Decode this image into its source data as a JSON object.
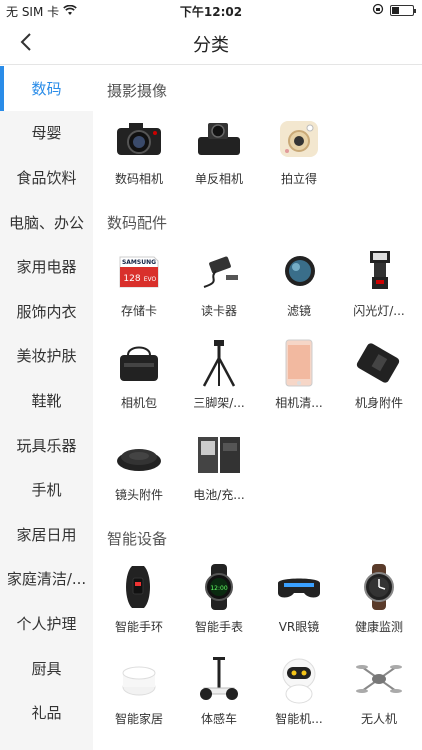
{
  "status_bar": {
    "carrier": "无 SIM 卡",
    "time": "下午12:02",
    "battery_level": 0.35
  },
  "nav": {
    "title": "分类"
  },
  "sidebar": {
    "items": [
      {
        "label": "数码",
        "active": true
      },
      {
        "label": "母婴"
      },
      {
        "label": "食品饮料"
      },
      {
        "label": "电脑、办公"
      },
      {
        "label": "家用电器"
      },
      {
        "label": "服饰内衣"
      },
      {
        "label": "美妆护肤"
      },
      {
        "label": "鞋靴"
      },
      {
        "label": "玩具乐器"
      },
      {
        "label": "手机"
      },
      {
        "label": "家居日用"
      },
      {
        "label": "家庭清洁/..."
      },
      {
        "label": "个人护理"
      },
      {
        "label": "厨具"
      },
      {
        "label": "礼品"
      }
    ]
  },
  "sections": [
    {
      "title": "摄影摄像",
      "items": [
        {
          "label": "数码相机",
          "icon": "dslr-camera-icon"
        },
        {
          "label": "单反相机",
          "icon": "compact-camera-icon"
        },
        {
          "label": "拍立得",
          "icon": "instant-camera-icon"
        }
      ]
    },
    {
      "title": "数码配件",
      "items": [
        {
          "label": "存储卡",
          "icon": "memory-card-icon",
          "card_text": "SAMSUNG",
          "card_size": "128"
        },
        {
          "label": "读卡器",
          "icon": "card-reader-icon"
        },
        {
          "label": "滤镜",
          "icon": "lens-filter-icon"
        },
        {
          "label": "闪光灯/...",
          "icon": "flash-icon"
        },
        {
          "label": "相机包",
          "icon": "camera-bag-icon"
        },
        {
          "label": "三脚架/...",
          "icon": "tripod-icon"
        },
        {
          "label": "相机清...",
          "icon": "screen-protector-icon"
        },
        {
          "label": "机身附件",
          "icon": "battery-grip-icon"
        },
        {
          "label": "镜头附件",
          "icon": "lens-cap-icon"
        },
        {
          "label": "电池/充...",
          "icon": "battery-icon"
        }
      ]
    },
    {
      "title": "智能设备",
      "items": [
        {
          "label": "智能手环",
          "icon": "smart-band-icon"
        },
        {
          "label": "智能手表",
          "icon": "smart-watch-icon"
        },
        {
          "label": "VR眼镜",
          "icon": "vr-glasses-icon"
        },
        {
          "label": "健康监测",
          "icon": "health-watch-icon"
        },
        {
          "label": "智能家居",
          "icon": "smart-speaker-icon"
        },
        {
          "label": "体感车",
          "icon": "balance-scooter-icon"
        },
        {
          "label": "智能机...",
          "icon": "robot-icon"
        },
        {
          "label": "无人机",
          "icon": "drone-icon"
        }
      ]
    }
  ],
  "colors": {
    "accent": "#2a8ce8",
    "sidebar_bg": "#f5f5f5"
  }
}
